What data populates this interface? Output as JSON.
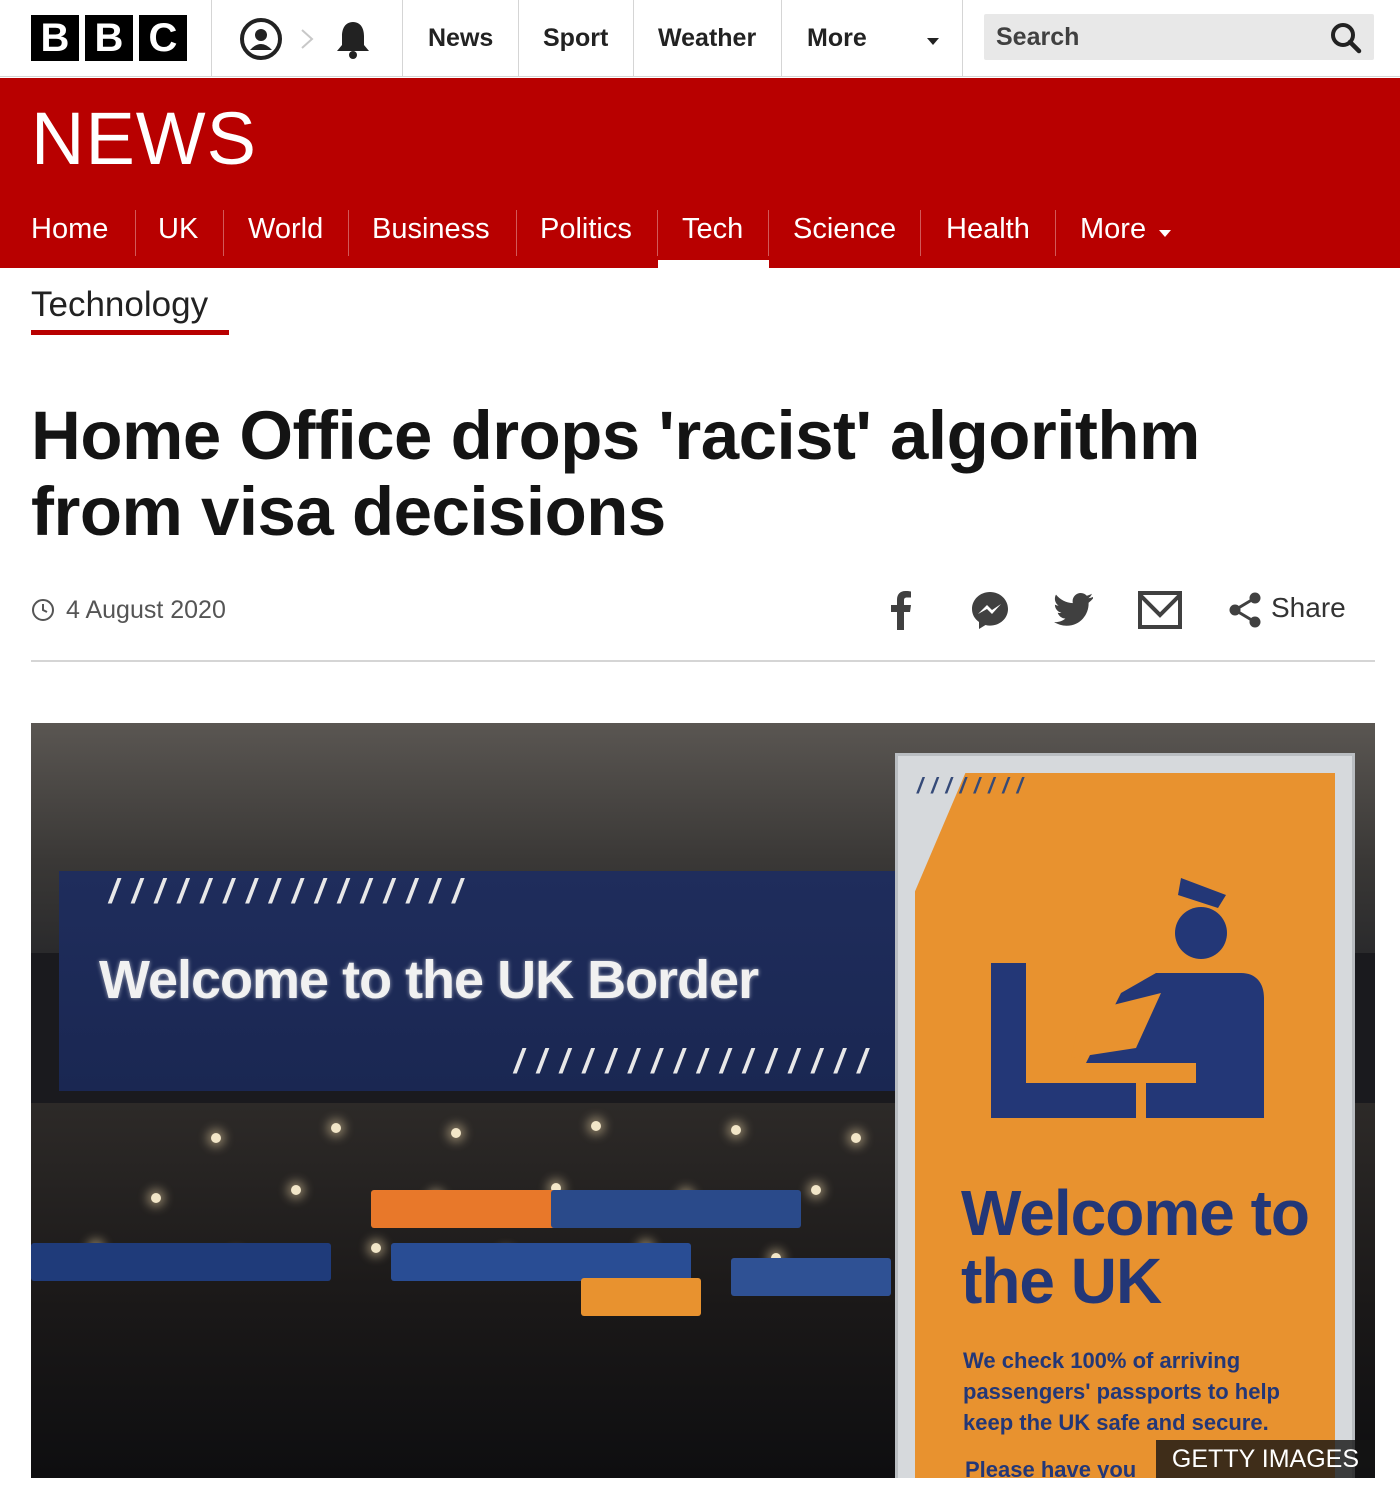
{
  "brand": {
    "logo_letters": [
      "B",
      "B",
      "C"
    ]
  },
  "topbar": {
    "nav": [
      "News",
      "Sport",
      "Weather",
      "More"
    ],
    "search_placeholder": "Search"
  },
  "news": {
    "title": "NEWS",
    "nav": [
      "Home",
      "UK",
      "World",
      "Business",
      "Politics",
      "Tech",
      "Science",
      "Health",
      "More"
    ],
    "active": "Tech"
  },
  "section": {
    "label": "Technology"
  },
  "article": {
    "headline": "Home Office drops 'racist' algorithm from visa decisions",
    "date": "4 August 2020",
    "share_label": "Share"
  },
  "hero": {
    "sign_text": "Welcome to the UK Border",
    "panel_title": "Welcome to the UK",
    "panel_text": "We check 100% of arriving passengers' passports to help keep the UK safe and secure.",
    "panel_text_2": "Please have you",
    "credit": "GETTY IMAGES"
  },
  "colors": {
    "brand_red": "#b80000",
    "sign_blue": "#1f2d5c",
    "sign_orange": "#e8922f"
  }
}
